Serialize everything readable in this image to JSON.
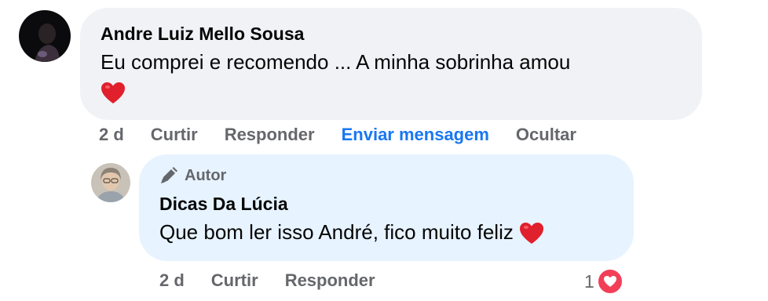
{
  "comment": {
    "author": "Andre Luiz Mello Sousa",
    "text": "Eu comprei e recomendo ... A minha sobrinha amou",
    "emoji": "heart-icon",
    "actions": {
      "time": "2 d",
      "like": "Curtir",
      "reply": "Responder",
      "message": "Enviar mensagem",
      "hide": "Ocultar"
    }
  },
  "reply": {
    "badge": "Autor",
    "author": "Dicas Da Lúcia",
    "text": "Que bom ler isso André, fico muito feliz",
    "emoji": "heart-icon",
    "actions": {
      "time": "2 d",
      "like": "Curtir",
      "reply": "Responder"
    },
    "reaction_count": "1",
    "reaction_icon": "love-reaction-icon"
  },
  "colors": {
    "comment_bubble": "#f0f2f5",
    "reply_bubble": "#e7f3ff",
    "link_blue": "#1877f2",
    "muted_text": "#65676b",
    "heart_red": "#f33e58"
  }
}
